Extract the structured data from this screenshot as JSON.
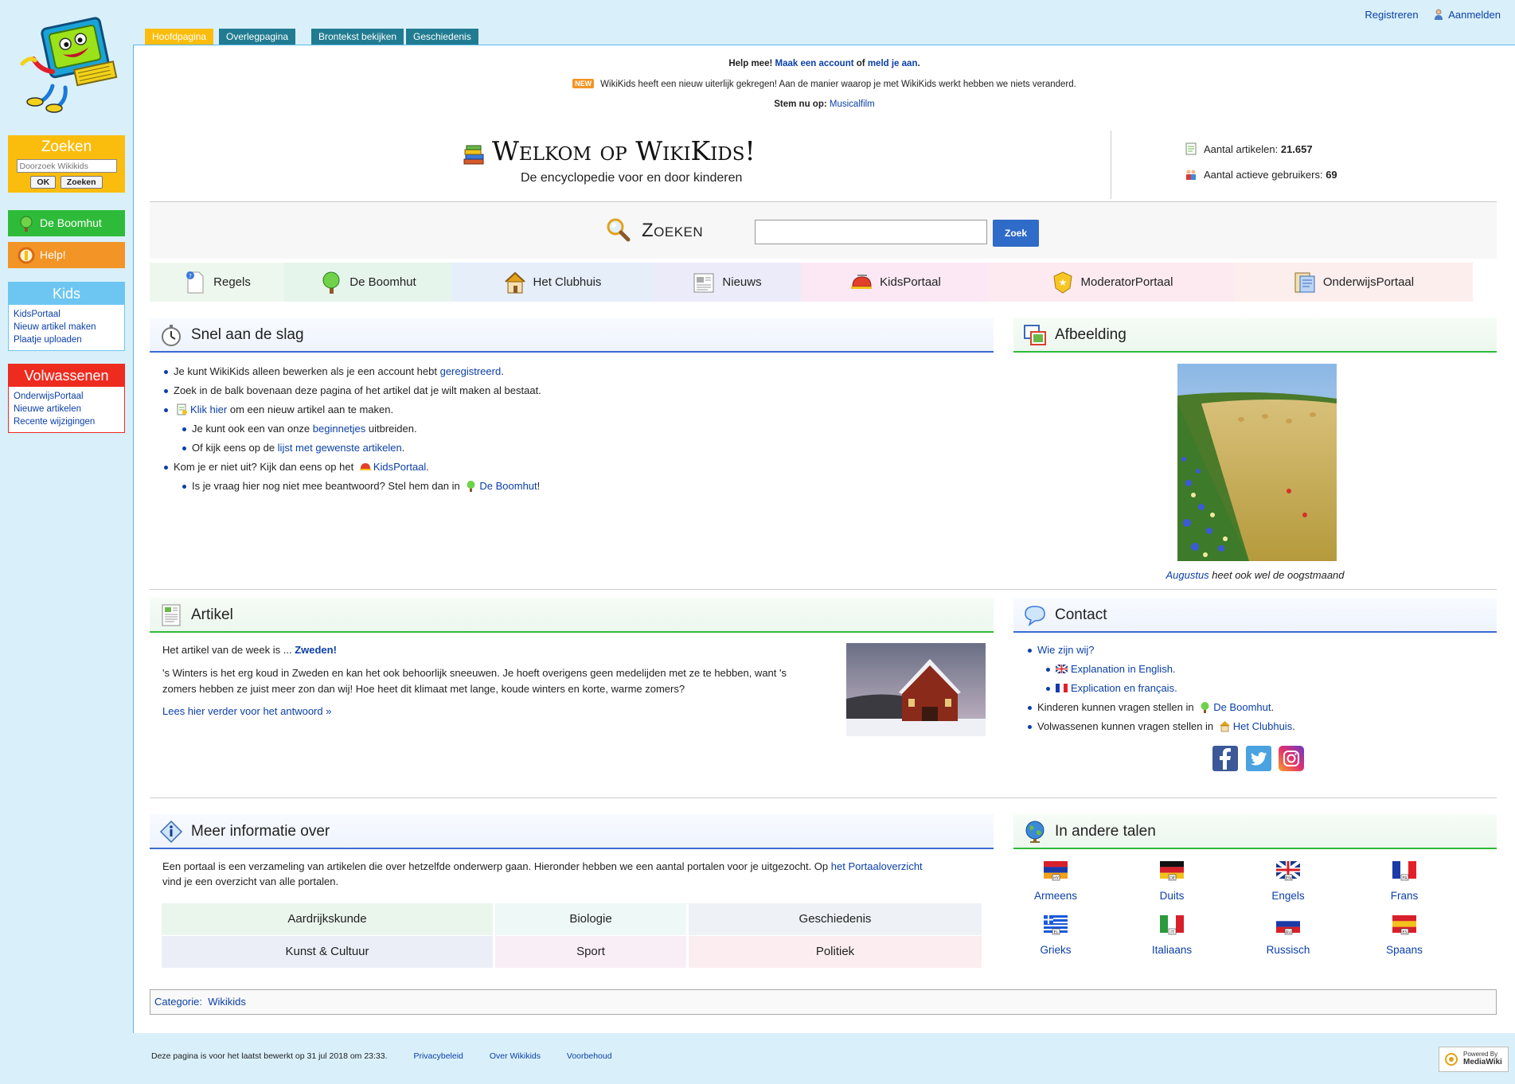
{
  "personal": {
    "register": "Registreren",
    "login": "Aanmelden"
  },
  "tabs": [
    "Hoofdpagina",
    "Overlegpagina",
    "Brontekst bekijken",
    "Geschiedenis"
  ],
  "sidebar": {
    "search": {
      "title": "Zoeken",
      "placeholder": "Doorzoek Wikikids",
      "ok": "OK",
      "go": "Zoeken"
    },
    "boomhut": "De Boomhut",
    "help": "Help!",
    "kids": {
      "title": "Kids",
      "links": [
        "KidsPortaal",
        "Nieuw artikel maken",
        "Plaatje uploaden"
      ]
    },
    "adults": {
      "title": "Volwassenen",
      "links": [
        "OnderwijsPortaal",
        "Nieuwe artikelen",
        "Recente wijzigingen"
      ]
    }
  },
  "notices": {
    "help_prefix": "Help mee! ",
    "help_link1": "Maak een account",
    "help_mid": " of ",
    "help_link2": "meld je aan",
    "help_end": ".",
    "new_badge": "NEW",
    "new_text": "WikiKids heeft een nieuw uiterlijk gekregen! Aan de manier waarop je met WikiKids werkt hebben we niets veranderd.",
    "vote_label": "Stem nu op:",
    "vote_link": "Musicalfilm"
  },
  "welcome": {
    "title": "Welkom op WikiKids!",
    "subtitle": "De encyclopedie voor en door kinderen",
    "articles_label": "Aantal artikelen: ",
    "articles_value": "21.657",
    "users_label": "Aantal actieve gebruikers: ",
    "users_value": "69"
  },
  "search": {
    "title": "Zoeken",
    "button": "Zoek",
    "value": ""
  },
  "portal_nav": [
    {
      "label": "Regels",
      "color": "#eef7ee"
    },
    {
      "label": "De Boomhut",
      "color": "#e6f5ec"
    },
    {
      "label": "Het Clubhuis",
      "color": "#e6eefa"
    },
    {
      "label": "Nieuws",
      "color": "#ecebfa"
    },
    {
      "label": "KidsPortaal",
      "color": "#fbe8f4"
    },
    {
      "label": "ModeratorPortaal",
      "color": "#fdeaf0"
    },
    {
      "label": "OnderwijsPortaal",
      "color": "#fdeeee"
    }
  ],
  "snel": {
    "title": "Snel aan de slag",
    "b1_text": "Je kunt WikiKids alleen bewerken als je een account hebt ",
    "b1_link": "geregistreerd",
    "b1_end": ".",
    "b2_text": "Zoek in de balk bovenaan deze pagina of het artikel dat je wilt maken al bestaat.",
    "b3_link": "Klik hier",
    "b3_text": " om een nieuw artikel aan te maken.",
    "b4_text": "Je kunt ook een van onze ",
    "b4_link": "beginnetjes",
    "b4_end": " uitbreiden.",
    "b5_text": "Of kijk eens op de ",
    "b5_link": "lijst met gewenste artikelen",
    "b5_end": ".",
    "b6_text": "Kom je er niet uit? Kijk dan eens op het ",
    "b6_link": "KidsPortaal",
    "b6_end": ".",
    "b7_text": "Is je vraag hier nog niet mee beantwoord? Stel hem dan in ",
    "b7_link": "De Boomhut",
    "b7_end": "!"
  },
  "afbeelding": {
    "title": "Afbeelding",
    "caption_link": "Augustus",
    "caption_text": " heet ook wel de oogstmaand"
  },
  "artikel": {
    "title": "Artikel",
    "intro": "Het artikel van de week is ... ",
    "intro_link": "Zweden!",
    "body": "'s Winters is het erg koud in Zweden en kan het ook behoorlijk sneeuwen. Je hoeft overigens geen medelijden met ze te hebben, want 's zomers hebben ze juist meer zon dan wij! Hoe heet dit klimaat met lange, koude winters en korte, warme zomers?",
    "more": "Lees hier verder voor het antwoord »"
  },
  "contact": {
    "title": "Contact",
    "who": "Wie zijn wij?",
    "en": "Explanation in English.",
    "fr": "Explication en français.",
    "kids_text": "Kinderen kunnen vragen stellen in ",
    "kids_link": "De Boomhut",
    "kids_end": ".",
    "adults_text": "Volwassenen kunnen vragen stellen in ",
    "adults_link": "Het Clubhuis",
    "adults_end": "."
  },
  "meer": {
    "title": "Meer informatie over",
    "text": "Een portaal is een verzameling van artikelen die over hetzelfde onderwerp gaan. Hieronder hebben we een aantal portalen voor je uitgezocht. Op ",
    "link": "het Portaaloverzicht",
    "end": " vind je een overzicht van alle portalen.",
    "portals": [
      [
        {
          "label": "Aardrijkskunde",
          "color": "#eaf6ec"
        },
        {
          "label": "Biologie",
          "color": "#eef8f7"
        },
        {
          "label": "Geschiedenis",
          "color": "#eef1f6"
        }
      ],
      [
        {
          "label": "Kunst & Cultuur",
          "color": "#eceef7"
        },
        {
          "label": "Sport",
          "color": "#f9eef6"
        },
        {
          "label": "Politiek",
          "color": "#fbedf0"
        }
      ]
    ]
  },
  "talen": {
    "title": "In andere talen",
    "langs": [
      "Armeens",
      "Duits",
      "Engels",
      "Frans",
      "Grieks",
      "Italiaans",
      "Russisch",
      "Spaans"
    ],
    "codes": [
      "HY",
      "DE",
      "EN",
      "FR",
      "EL",
      "IT",
      "RU",
      "ES"
    ]
  },
  "category": {
    "label": "Categorie:",
    "value": "Wikikids"
  },
  "footer": {
    "lastedit": "Deze pagina is voor het laatst bewerkt op 31 jul 2018 om 23:33.",
    "privacy": "Privacybeleid",
    "about": "Over Wikikids",
    "disclaimer": "Voorbehoud",
    "badge_top": "Powered By",
    "badge_main": "MediaWiki"
  }
}
